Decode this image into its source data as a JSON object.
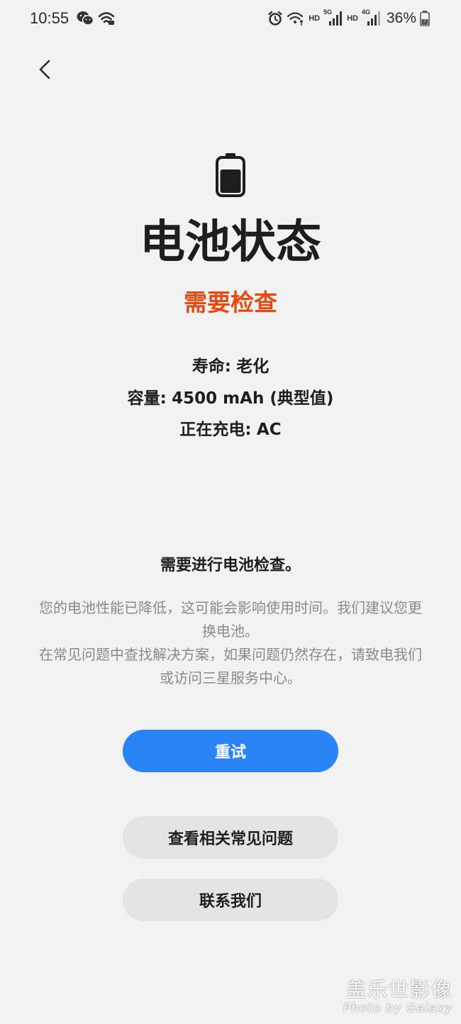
{
  "status_bar": {
    "time": "10:55",
    "hd_1": "HD",
    "net_1": "5G",
    "hd_2": "HD",
    "net_2": "4G",
    "battery_percent": "36%",
    "icons": [
      "wechat-icon",
      "wifi-icon",
      "alarm-icon",
      "wifi-calling-icon",
      "signal-icon",
      "battery-charging-icon"
    ]
  },
  "header": {
    "back_icon": "chevron-left-icon"
  },
  "main": {
    "hero_icon": "battery-icon",
    "title": "电池状态",
    "status": "需要检查",
    "status_color": "#e44a12",
    "info": {
      "life_label": "寿命:",
      "life_value": "老化",
      "capacity_label": "容量:",
      "capacity_value": "4500 mAh (典型值)",
      "charging_label": "正在充电:",
      "charging_value": "AC"
    },
    "notice_title": "需要进行电池检查。",
    "notice_body_1": "您的电池性能已降低，这可能会影响使用时间。我们建议您更换电池。",
    "notice_body_2": "在常见问题中查找解决方案，如果问题仍然存在，请致电我们或访问三星服务中心。"
  },
  "actions": {
    "retry_label": "重试",
    "faq_label": "查看相关常见问题",
    "contact_label": "联系我们",
    "primary_color": "#2b84f5"
  },
  "watermark": {
    "line1": "盖乐世影像",
    "line2": "Photo by Galaxy"
  }
}
